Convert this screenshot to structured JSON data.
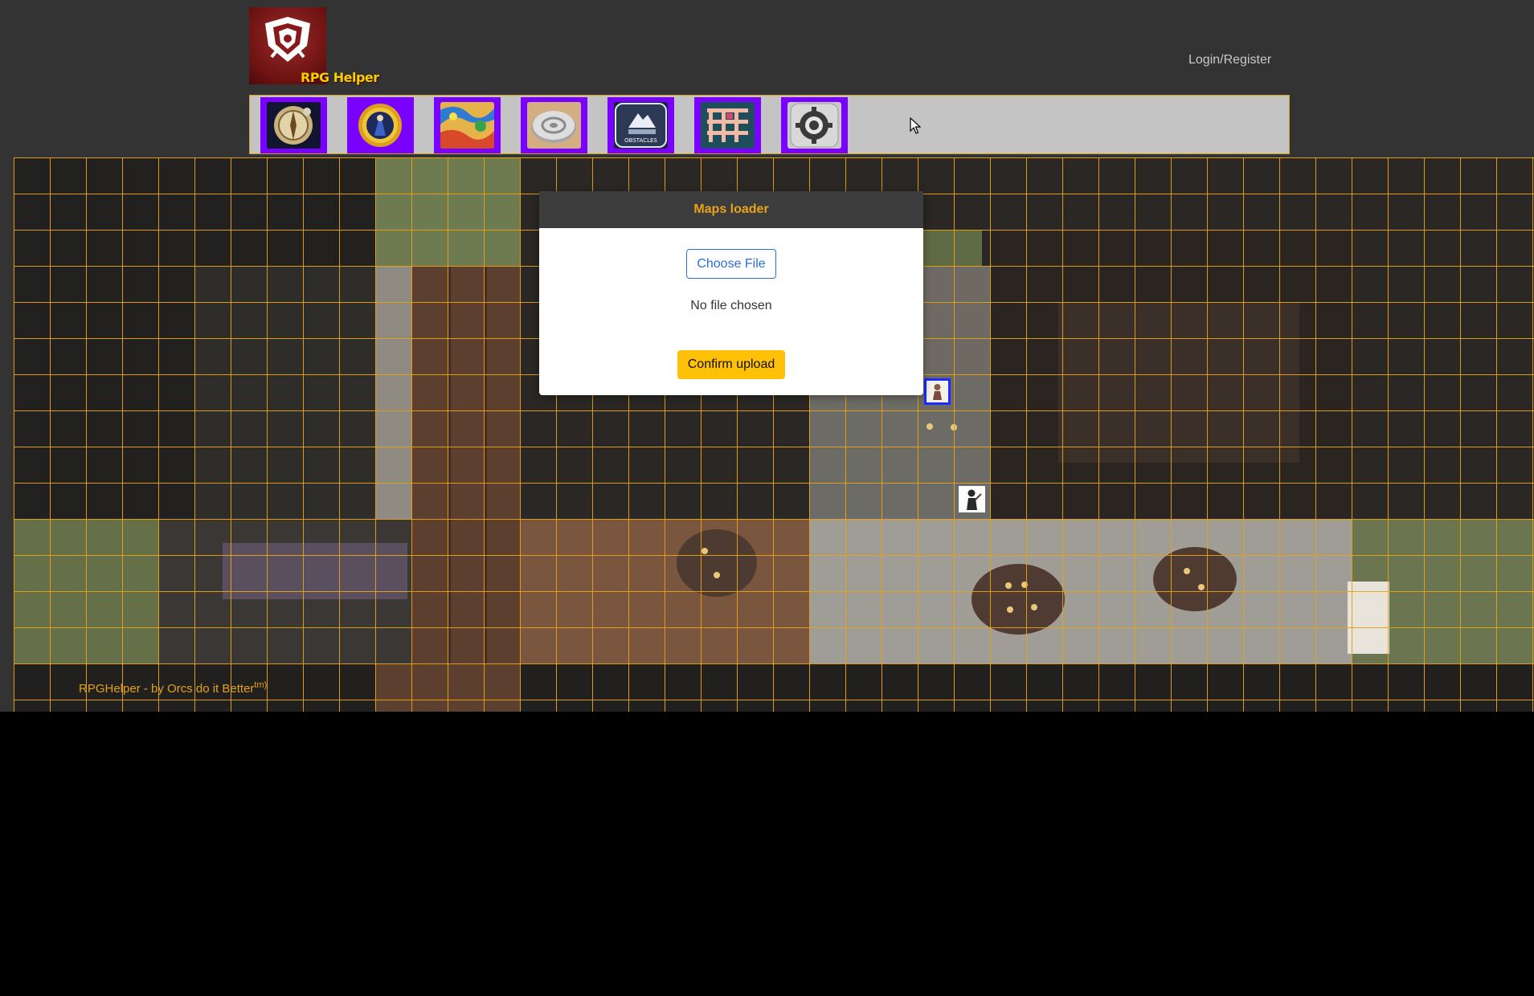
{
  "header": {
    "logo_text": "RPG Helper",
    "login_label": "Login/Register"
  },
  "toolbar": {
    "tools": [
      {
        "icon": "compass-map-icon"
      },
      {
        "icon": "wizard-coin-icon"
      },
      {
        "icon": "colorful-map-icon"
      },
      {
        "icon": "disc-token-icon"
      },
      {
        "icon": "obstacles-icon",
        "caption": "OBSTACLES"
      },
      {
        "icon": "grid-maze-icon"
      },
      {
        "icon": "settings-gear-icon"
      }
    ]
  },
  "modal": {
    "title": "Maps loader",
    "choose_label": "Choose File",
    "file_status": "No file chosen",
    "confirm_label": "Confirm upload"
  },
  "map": {
    "tokens": [
      {
        "icon": "character-token-icon",
        "selected": true
      },
      {
        "icon": "character-token-icon",
        "selected": false
      }
    ]
  },
  "footer": {
    "text": "RPGHelper - by Orcs do it Better",
    "sup": "tm)"
  },
  "colors": {
    "accent": "#e8a21c",
    "tool_bg": "#7a00ff",
    "page_bg": "#333333",
    "toolbar_bg": "#c4c4c4"
  }
}
